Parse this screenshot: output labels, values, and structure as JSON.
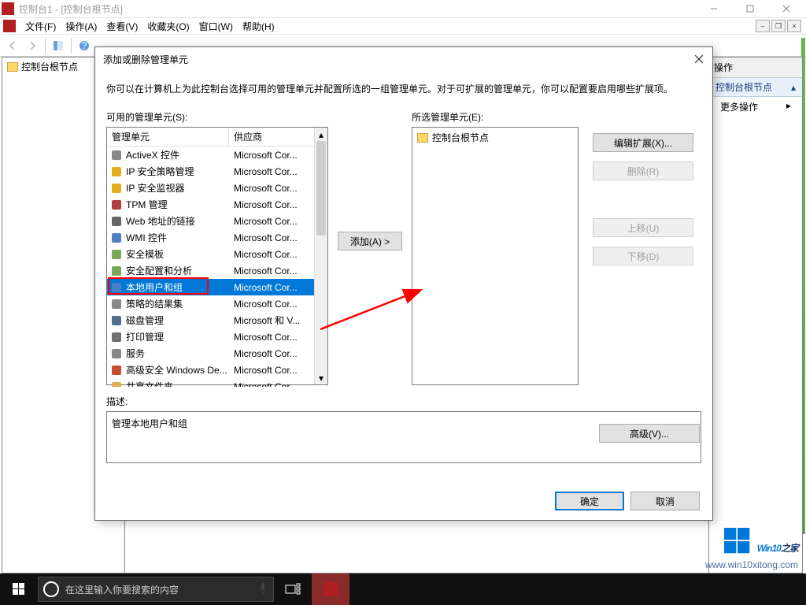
{
  "window": {
    "title": "控制台1 - [控制台根节点]"
  },
  "menu": {
    "file": "文件(F)",
    "action": "操作(A)",
    "view": "查看(V)",
    "fav": "收藏夹(O)",
    "window": "窗口(W)",
    "help": "帮助(H)"
  },
  "tree": {
    "root": "控制台根节点"
  },
  "actions": {
    "header": "操作",
    "group": "控制台根节点",
    "more": "更多操作"
  },
  "dialog": {
    "title": "添加或删除管理单元",
    "intro": "你可以在计算机上为此控制台选择可用的管理单元并配置所选的一组管理单元。对于可扩展的管理单元，你可以配置要启用哪些扩展项。",
    "available_label": "可用的管理单元(S):",
    "selected_label": "所选管理单元(E):",
    "col_snapin": "管理单元",
    "col_vendor": "供应商",
    "add_btn": "添加(A) >",
    "edit_ext": "编辑扩展(X)...",
    "remove": "删除(R)",
    "up": "上移(U)",
    "down": "下移(D)",
    "advanced": "高级(V)...",
    "desc_label": "描述:",
    "desc_text": "管理本地用户和组",
    "ok": "确定",
    "cancel": "取消",
    "selected_root": "控制台根节点",
    "snapins": [
      {
        "name": "ActiveX 控件",
        "vendor": "Microsoft Cor...",
        "icon": "gear"
      },
      {
        "name": "IP 安全策略管理",
        "vendor": "Microsoft Cor...",
        "icon": "shield"
      },
      {
        "name": "IP 安全监视器",
        "vendor": "Microsoft Cor...",
        "icon": "shield"
      },
      {
        "name": "TPM 管理",
        "vendor": "Microsoft Cor...",
        "icon": "chip"
      },
      {
        "name": "Web 地址的链接",
        "vendor": "Microsoft Cor...",
        "icon": "link"
      },
      {
        "name": "WMI 控件",
        "vendor": "Microsoft Cor...",
        "icon": "wmi"
      },
      {
        "name": "安全模板",
        "vendor": "Microsoft Cor...",
        "icon": "doc"
      },
      {
        "name": "安全配置和分析",
        "vendor": "Microsoft Cor...",
        "icon": "doc"
      },
      {
        "name": "本地用户和组",
        "vendor": "Microsoft Cor...",
        "icon": "users",
        "selected": true
      },
      {
        "name": "策略的结果集",
        "vendor": "Microsoft Cor...",
        "icon": "policy"
      },
      {
        "name": "磁盘管理",
        "vendor": "Microsoft 和 V...",
        "icon": "disk"
      },
      {
        "name": "打印管理",
        "vendor": "Microsoft Cor...",
        "icon": "printer"
      },
      {
        "name": "服务",
        "vendor": "Microsoft Cor...",
        "icon": "gears"
      },
      {
        "name": "高级安全 Windows De...",
        "vendor": "Microsoft Cor...",
        "icon": "firewall"
      },
      {
        "name": "共享文件夹",
        "vendor": "Microsoft Cor...",
        "icon": "folder"
      }
    ]
  },
  "taskbar": {
    "search_placeholder": "在这里输入你要搜索的内容"
  },
  "watermark": {
    "brand_a": "Win10",
    "brand_b": "之家",
    "url": "www.win10xitong.com"
  }
}
